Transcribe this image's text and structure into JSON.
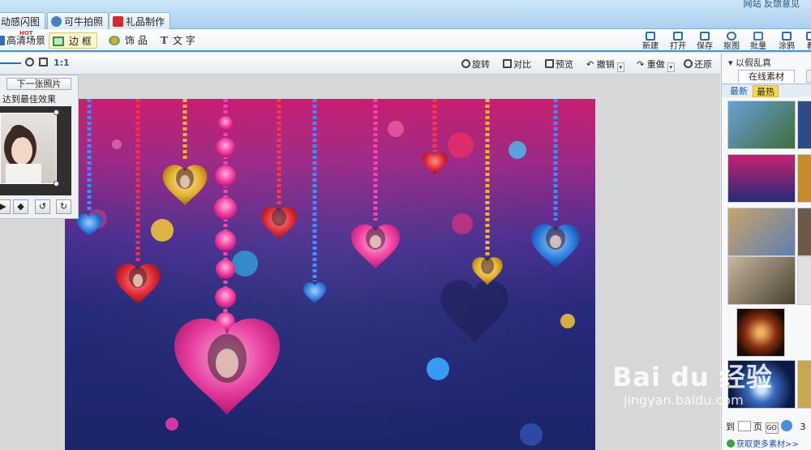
{
  "top_tabs": [
    {
      "label": "动感闪图",
      "icon": "flash-icon"
    },
    {
      "label": "可牛拍照",
      "icon": "camera-icon"
    },
    {
      "label": "礼品制作",
      "icon": "gift-icon"
    }
  ],
  "top_links": "网站  反馈意见",
  "modes": [
    {
      "label": "高清场景",
      "badge": "HOT",
      "icon": "scene-icon"
    },
    {
      "label": "边 框",
      "icon": "frame-icon"
    },
    {
      "label": "饰 品",
      "icon": "decoration-icon"
    },
    {
      "label": "文 字",
      "icon": "text-icon"
    }
  ],
  "file_buttons": [
    "新建",
    "打开",
    "保存",
    "抠图",
    "批量",
    "涂鸦",
    "教"
  ],
  "zoom_label": "1:1",
  "edit_tools": {
    "rotate": "旋转",
    "compare": "对比",
    "preview": "预览",
    "undo": "撤销",
    "redo": "重做",
    "restore": "还原"
  },
  "photo_panel": {
    "next_label": "下一张照片",
    "best_effect": "达到最佳效果"
  },
  "right_panel": {
    "title": "以假乱真",
    "tab": "在线素材",
    "subtabs": [
      "最新",
      "最热"
    ],
    "pager_page": "页",
    "pager_go": "GO",
    "pager_prefix": "到",
    "pager_count": "3",
    "more_link": "获取更多素材>>"
  },
  "watermark": {
    "line1": "Bai du 经验",
    "line2": "jingyan.baidu.com"
  }
}
